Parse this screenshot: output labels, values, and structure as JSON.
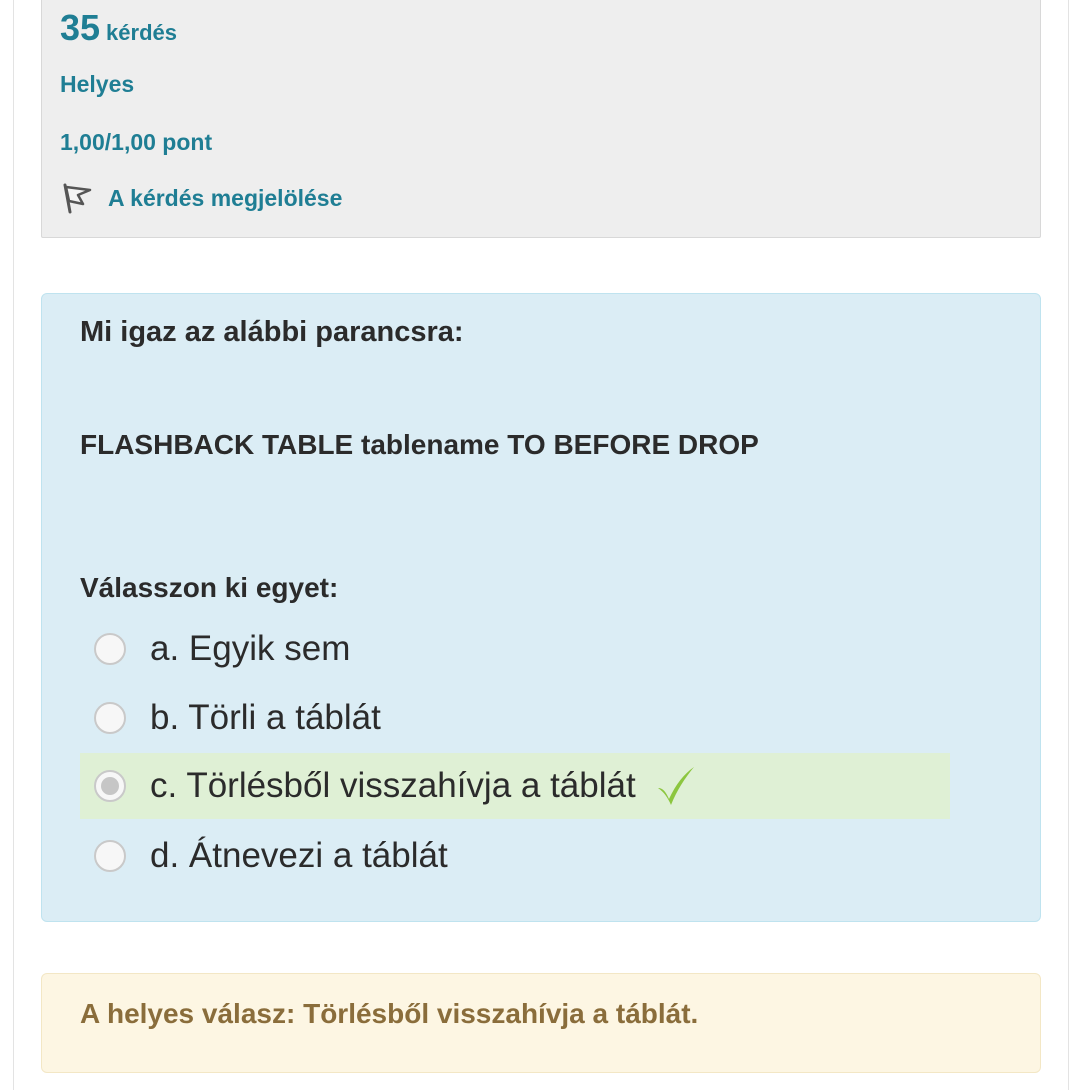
{
  "info": {
    "question_number": "35",
    "question_word": "kérdés",
    "state": "Helyes",
    "grade": "1,00/1,00 pont",
    "flag_label": "A kérdés megjelölése"
  },
  "question": {
    "text": "Mi igaz az alábbi parancsra:",
    "code": "FLASHBACK TABLE tablename TO BEFORE DROP",
    "prompt": "Válasszon ki egyet:",
    "options": [
      {
        "label": "a. Egyik sem",
        "selected": false,
        "correct": false
      },
      {
        "label": "b. Törli a táblát",
        "selected": false,
        "correct": false
      },
      {
        "label": "c. Törlésből visszahívja a táblát",
        "selected": true,
        "correct": true
      },
      {
        "label": "d. Átnevezi a táblát",
        "selected": false,
        "correct": false
      }
    ]
  },
  "feedback": {
    "right_answer": "A helyes válasz: Törlésből visszahívja a táblát."
  },
  "colors": {
    "accent": "#1f7e94",
    "question_bg": "#dbedf5",
    "correct_bg": "#dff0d5",
    "check": "#8cc63f",
    "feedback_bg": "#fdf6e3",
    "feedback_text": "#8a6d3b"
  },
  "icons": {
    "flag": "flag-icon",
    "correct": "checkmark-icon"
  }
}
